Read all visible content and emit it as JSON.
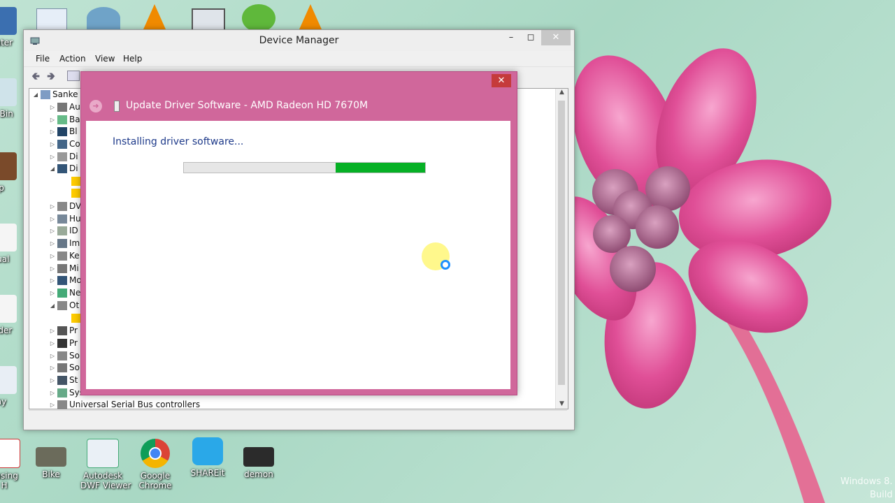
{
  "desktop": {
    "left_icons": [
      {
        "label": "puter"
      },
      {
        "label": "le Bin"
      },
      {
        "label": "p"
      },
      {
        "label": "tual"
      },
      {
        "label": "older"
      },
      {
        "label": "ay"
      }
    ],
    "bottom_icons": [
      {
        "label": "ousing\nH"
      },
      {
        "label": "Bike"
      },
      {
        "label": "Autodesk\nDWF Viewer"
      },
      {
        "label": "Google\nChrome"
      },
      {
        "label": "SHAREit"
      },
      {
        "label": "demon"
      }
    ],
    "watermark_line1": "Windows 8.",
    "watermark_line2": "Build"
  },
  "device_manager": {
    "title": "Device Manager",
    "menu": [
      "File",
      "Action",
      "View",
      "Help"
    ],
    "tree": {
      "root": "Sanke",
      "items": [
        {
          "label": "Au",
          "expander": "▷"
        },
        {
          "label": "Ba",
          "expander": "▷"
        },
        {
          "label": "Bl",
          "expander": "▷"
        },
        {
          "label": "Co",
          "expander": "▷"
        },
        {
          "label": "Di",
          "expander": "▷"
        },
        {
          "label": "Di",
          "expander": "◢"
        },
        {
          "label": "",
          "expander": ""
        },
        {
          "label": "",
          "expander": ""
        },
        {
          "label": "DV",
          "expander": "▷"
        },
        {
          "label": "Hu",
          "expander": "▷"
        },
        {
          "label": "ID",
          "expander": "▷"
        },
        {
          "label": "Im",
          "expander": "▷"
        },
        {
          "label": "Ke",
          "expander": "▷"
        },
        {
          "label": "Mi",
          "expander": "▷"
        },
        {
          "label": "Mo",
          "expander": "▷"
        },
        {
          "label": "Ne",
          "expander": "▷"
        },
        {
          "label": "Ot",
          "expander": "◢"
        },
        {
          "label": "",
          "expander": ""
        },
        {
          "label": "Pr",
          "expander": "▷"
        },
        {
          "label": "Pr",
          "expander": "▷"
        },
        {
          "label": "So",
          "expander": "▷"
        },
        {
          "label": "So",
          "expander": "▷"
        },
        {
          "label": "St",
          "expander": "▷"
        },
        {
          "label": "System devices",
          "expander": "▷"
        },
        {
          "label": "Universal Serial Bus controllers",
          "expander": "▷"
        }
      ]
    }
  },
  "update_dialog": {
    "title": "Update Driver Software - AMD Radeon HD 7670M",
    "status": "Installing driver software...",
    "progress_segment_start": 0.63,
    "progress_segment_end": 1.0,
    "accent_color": "#d0679b",
    "progress_color": "#06b025"
  }
}
